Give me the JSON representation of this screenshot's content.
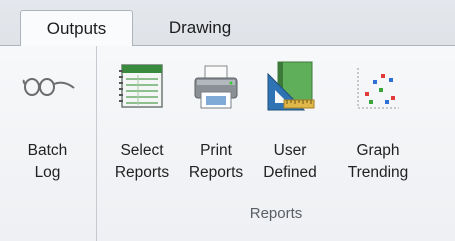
{
  "tabs": [
    {
      "label": "Outputs",
      "active": true
    },
    {
      "label": "Drawing",
      "active": false
    }
  ],
  "buttons": [
    {
      "line1": "Batch",
      "line2": "Log",
      "icon": "glasses-icon"
    },
    {
      "line1": "Select",
      "line2": "Reports",
      "icon": "report-sheet-icon"
    },
    {
      "line1": "Print",
      "line2": "Reports",
      "icon": "printer-icon"
    },
    {
      "line1": "User",
      "line2": "Defined",
      "icon": "ruler-book-icon"
    },
    {
      "line1": "Graph",
      "line2": "Trending",
      "icon": "scatter-plot-icon"
    }
  ],
  "group": {
    "label": "Reports"
  }
}
